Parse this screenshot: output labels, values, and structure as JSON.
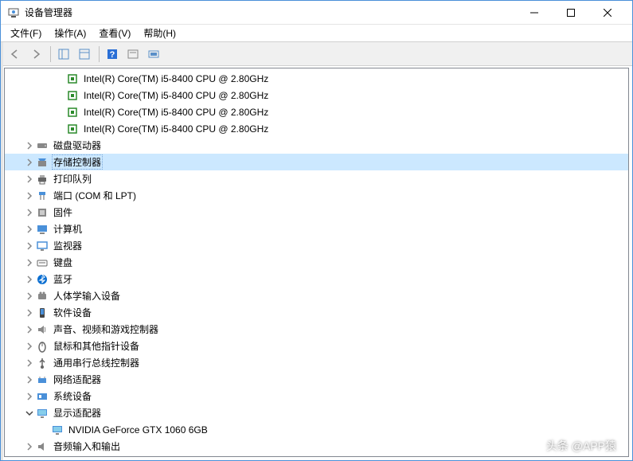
{
  "window": {
    "title": "设备管理器"
  },
  "menu": {
    "file": "文件(F)",
    "action": "操作(A)",
    "view": "查看(V)",
    "help": "帮助(H)"
  },
  "tree": {
    "cpu_items": [
      "Intel(R) Core(TM) i5-8400 CPU @ 2.80GHz",
      "Intel(R) Core(TM) i5-8400 CPU @ 2.80GHz",
      "Intel(R) Core(TM) i5-8400 CPU @ 2.80GHz",
      "Intel(R) Core(TM) i5-8400 CPU @ 2.80GHz"
    ],
    "categories": {
      "disk_drives": "磁盘驱动器",
      "storage_controllers": "存储控制器",
      "print_queues": "打印队列",
      "ports": "端口 (COM 和 LPT)",
      "firmware": "固件",
      "computer": "计算机",
      "monitors": "监视器",
      "keyboards": "键盘",
      "bluetooth": "蓝牙",
      "hid": "人体学输入设备",
      "software_devices": "软件设备",
      "sound": "声音、视频和游戏控制器",
      "mice": "鼠标和其他指针设备",
      "usb": "通用串行总线控制器",
      "network": "网络适配器",
      "system": "系统设备",
      "display": "显示适配器",
      "audio_io": "音频输入和输出"
    },
    "display_child": "NVIDIA GeForce GTX 1060 6GB"
  },
  "watermark": "头条 @APP猿"
}
